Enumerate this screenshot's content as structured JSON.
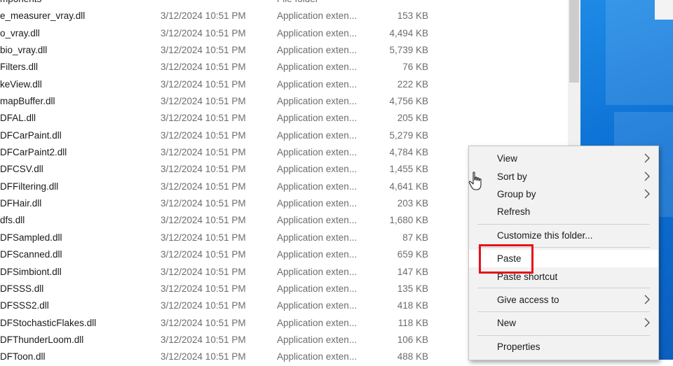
{
  "files": [
    {
      "name": "mponents",
      "date": "",
      "type": "File folder",
      "size": ""
    },
    {
      "name": "e_measurer_vray.dll",
      "date": "3/12/2024 10:51 PM",
      "type": "Application exten...",
      "size": "153 KB"
    },
    {
      "name": "o_vray.dll",
      "date": "3/12/2024 10:51 PM",
      "type": "Application exten...",
      "size": "4,494 KB"
    },
    {
      "name": "bio_vray.dll",
      "date": "3/12/2024 10:51 PM",
      "type": "Application exten...",
      "size": "5,739 KB"
    },
    {
      "name": "Filters.dll",
      "date": "3/12/2024 10:51 PM",
      "type": "Application exten...",
      "size": "76 KB"
    },
    {
      "name": "keView.dll",
      "date": "3/12/2024 10:51 PM",
      "type": "Application exten...",
      "size": "222 KB"
    },
    {
      "name": "mapBuffer.dll",
      "date": "3/12/2024 10:51 PM",
      "type": "Application exten...",
      "size": "4,756 KB"
    },
    {
      "name": "DFAL.dll",
      "date": "3/12/2024 10:51 PM",
      "type": "Application exten...",
      "size": "205 KB"
    },
    {
      "name": "DFCarPaint.dll",
      "date": "3/12/2024 10:51 PM",
      "type": "Application exten...",
      "size": "5,279 KB"
    },
    {
      "name": "DFCarPaint2.dll",
      "date": "3/12/2024 10:51 PM",
      "type": "Application exten...",
      "size": "4,784 KB"
    },
    {
      "name": "DFCSV.dll",
      "date": "3/12/2024 10:51 PM",
      "type": "Application exten...",
      "size": "1,455 KB"
    },
    {
      "name": "DFFiltering.dll",
      "date": "3/12/2024 10:51 PM",
      "type": "Application exten...",
      "size": "4,641 KB"
    },
    {
      "name": "DFHair.dll",
      "date": "3/12/2024 10:51 PM",
      "type": "Application exten...",
      "size": "203 KB"
    },
    {
      "name": "dfs.dll",
      "date": "3/12/2024 10:51 PM",
      "type": "Application exten...",
      "size": "1,680 KB"
    },
    {
      "name": "DFSampled.dll",
      "date": "3/12/2024 10:51 PM",
      "type": "Application exten...",
      "size": "87 KB"
    },
    {
      "name": "DFScanned.dll",
      "date": "3/12/2024 10:51 PM",
      "type": "Application exten...",
      "size": "659 KB"
    },
    {
      "name": "DFSimbiont.dll",
      "date": "3/12/2024 10:51 PM",
      "type": "Application exten...",
      "size": "147 KB"
    },
    {
      "name": "DFSSS.dll",
      "date": "3/12/2024 10:51 PM",
      "type": "Application exten...",
      "size": "135 KB"
    },
    {
      "name": "DFSSS2.dll",
      "date": "3/12/2024 10:51 PM",
      "type": "Application exten...",
      "size": "418 KB"
    },
    {
      "name": "DFStochasticFlakes.dll",
      "date": "3/12/2024 10:51 PM",
      "type": "Application exten...",
      "size": "118 KB"
    },
    {
      "name": "DFThunderLoom.dll",
      "date": "3/12/2024 10:51 PM",
      "type": "Application exten...",
      "size": "106 KB"
    },
    {
      "name": "DFToon.dll",
      "date": "3/12/2024 10:51 PM",
      "type": "Application exten...",
      "size": "488 KB"
    }
  ],
  "context_menu": {
    "view": "View",
    "sort_by": "Sort by",
    "group_by": "Group by",
    "refresh": "Refresh",
    "customize": "Customize this folder...",
    "paste": "Paste",
    "paste_shortcut": "Paste shortcut",
    "give_access": "Give access to",
    "new": "New",
    "properties": "Properties"
  },
  "icons": {
    "submenu": "chevron-right-icon",
    "pointer": "hand-cursor-icon"
  },
  "colors": {
    "highlight": "#e3131b",
    "desktop": "#0a6fd3",
    "menu_bg": "#f2f2f2",
    "muted_text": "#6d6d6d"
  }
}
